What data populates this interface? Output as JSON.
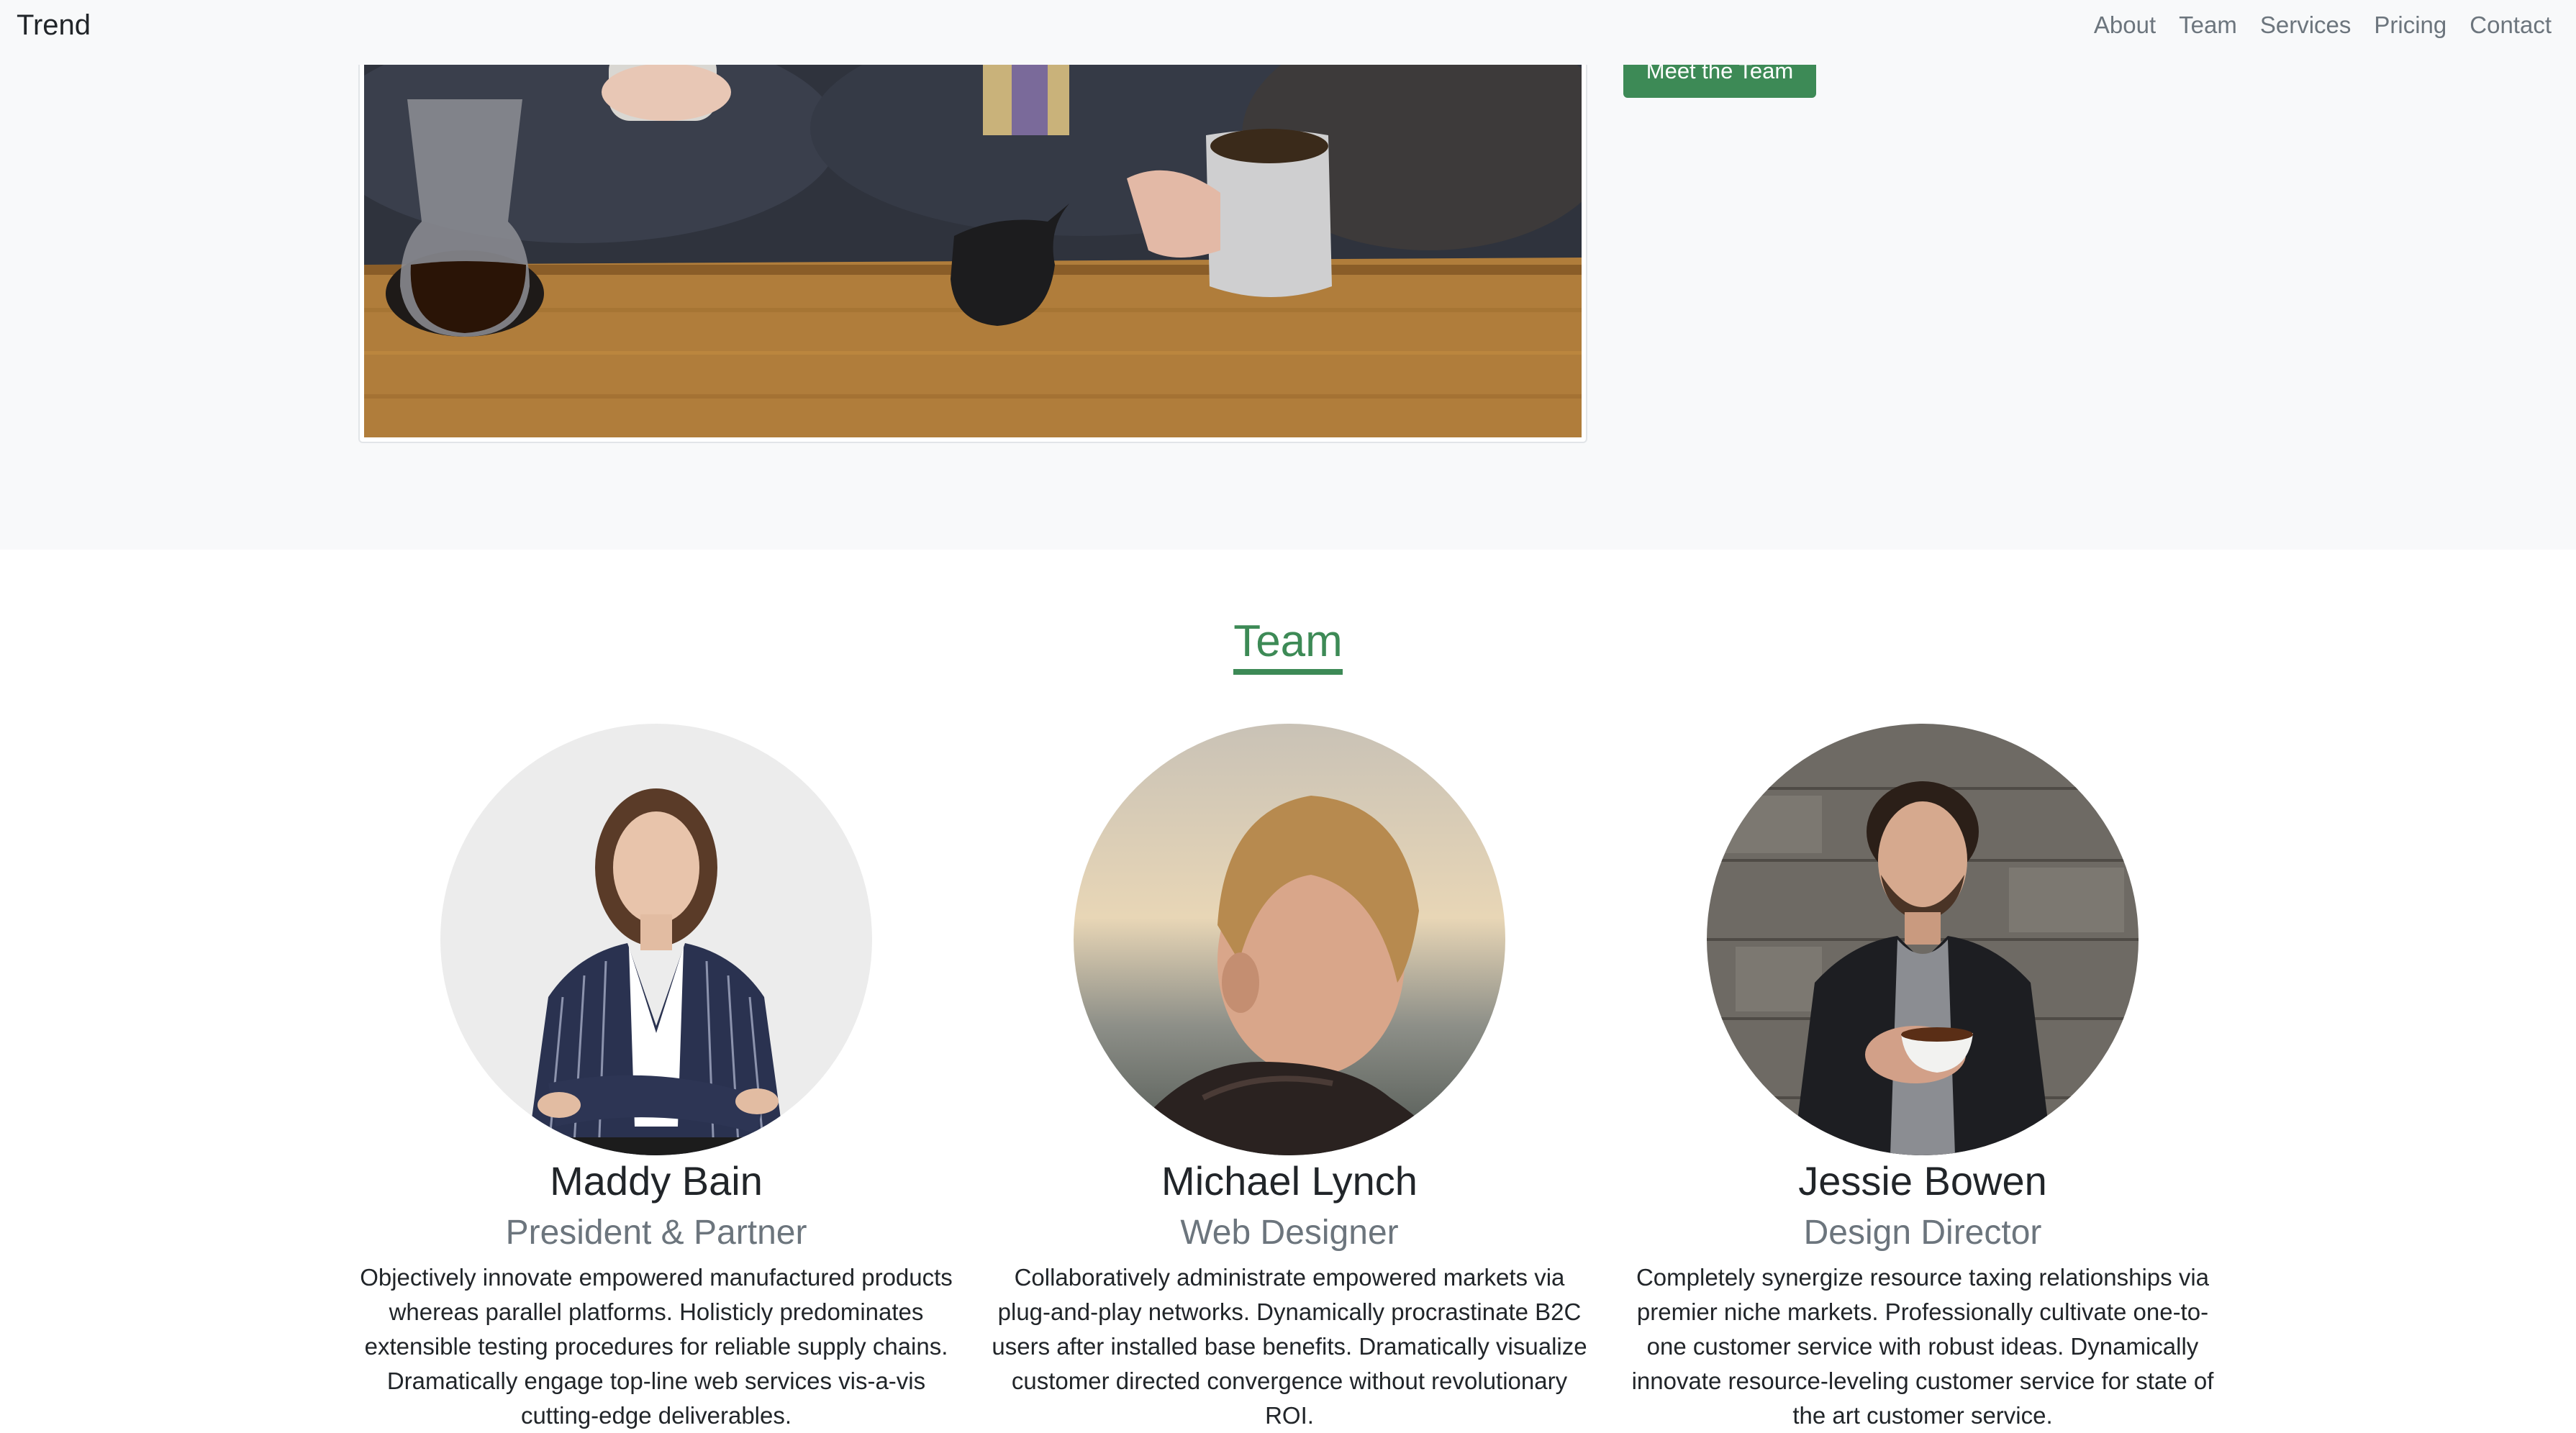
{
  "navbar": {
    "brand": "Trend",
    "links": [
      "About",
      "Team",
      "Services",
      "Pricing",
      "Contact"
    ]
  },
  "hero": {
    "button_label": "Meet the Team"
  },
  "team": {
    "title": "Team",
    "members": [
      {
        "name": "Maddy Bain",
        "role": "President & Partner",
        "bio": "Objectively innovate empowered manufactured products whereas parallel platforms. Holisticly predominates extensible testing procedures for reliable supply chains. Dramatically engage top-line web services vis-a-vis cutting-edge deliverables."
      },
      {
        "name": "Michael Lynch",
        "role": "Web Designer",
        "bio": "Collaboratively administrate empowered markets via plug-and-play networks. Dynamically procrastinate B2C users after installed base benefits. Dramatically visualize customer directed convergence without revolutionary ROI."
      },
      {
        "name": "Jessie Bowen",
        "role": "Design Director",
        "bio": "Completely synergize resource taxing relationships via premier niche markets. Professionally cultivate one-to-one customer service with robust ideas. Dynamically innovate resource-leveling customer service for state of the art customer service."
      }
    ]
  },
  "colors": {
    "accent": "#3d8a56",
    "navbar_bg": "#f8f9fa",
    "text_muted": "#6c757d"
  }
}
